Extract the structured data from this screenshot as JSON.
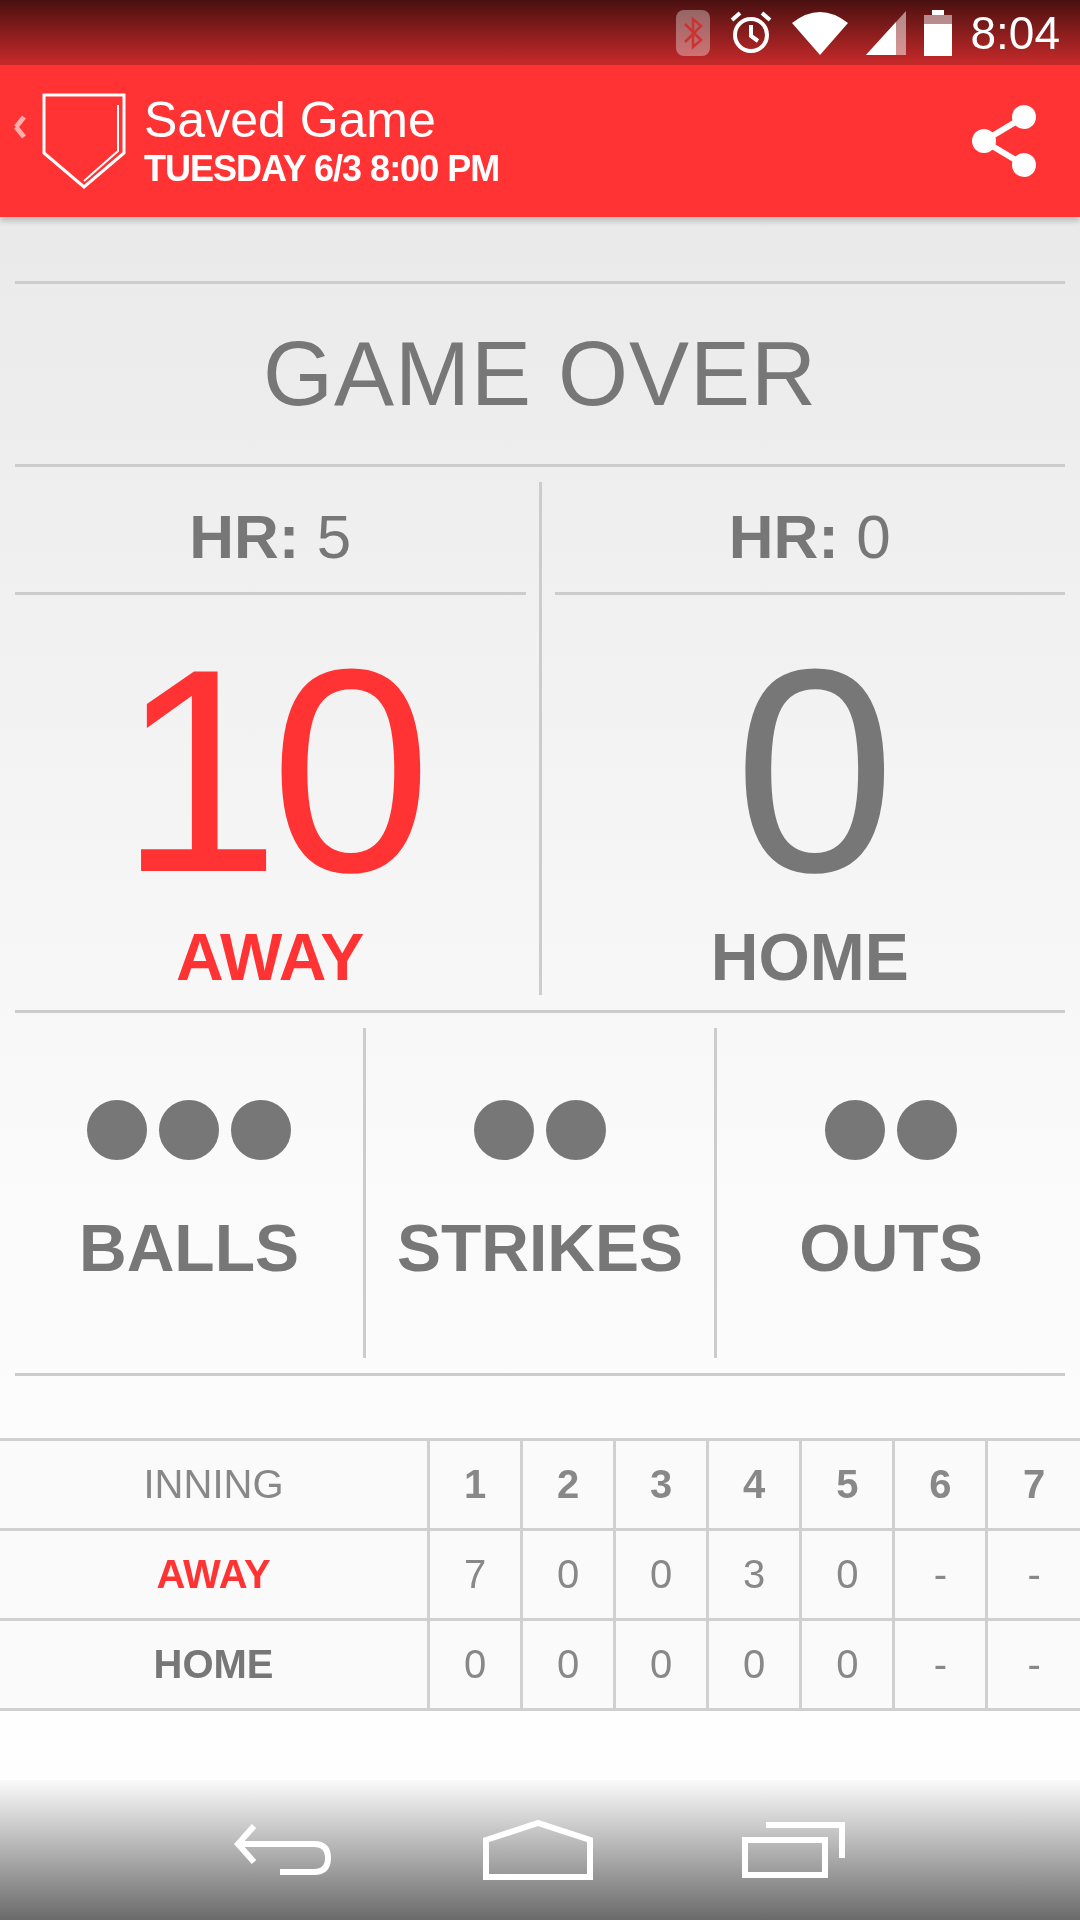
{
  "status_bar": {
    "time": "8:04"
  },
  "app_bar": {
    "title": "Saved Game",
    "subtitle": "TUESDAY 6/3 8:00 PM"
  },
  "game_status": "GAME OVER",
  "teams": [
    {
      "hr": "**HR:** 5",
      "score": "10",
      "name": "AWAY",
      "color": "#ff3333"
    },
    {
      "hr": "**HR:** 0",
      "score": "0",
      "name": "HOME",
      "color": "#777777"
    }
  ],
  "counts": [
    {
      "label": "BALLS",
      "dots": [
        {
          "on": true
        },
        {
          "on": true
        },
        {
          "on": true
        }
      ]
    },
    {
      "label": "STRIKES",
      "dots": [
        {
          "on": true
        },
        {
          "on": true
        }
      ]
    },
    {
      "label": "OUTS",
      "dots": [
        {
          "on": true
        },
        {
          "on": true
        }
      ]
    }
  ],
  "linescore": {
    "header": "INNING",
    "innings": [
      "1",
      "2",
      "3",
      "4",
      "5",
      "6",
      "7"
    ],
    "rows": [
      {
        "team": "AWAY",
        "color": "#ff3333",
        "runs": [
          "7",
          "0",
          "0",
          "3",
          "0",
          "-",
          "-"
        ]
      },
      {
        "team": "HOME",
        "color": "#777777",
        "runs": [
          "0",
          "0",
          "0",
          "0",
          "0",
          "-",
          "-"
        ]
      }
    ]
  }
}
